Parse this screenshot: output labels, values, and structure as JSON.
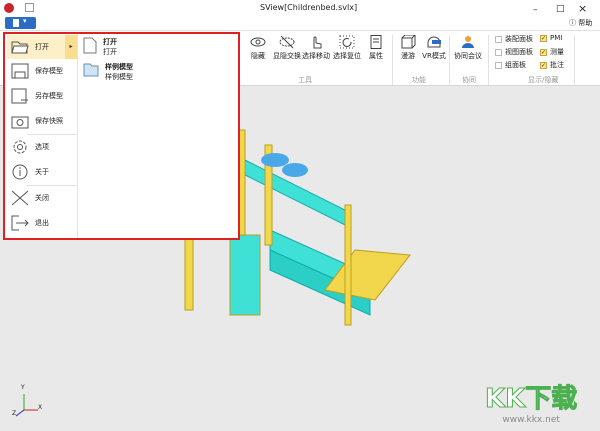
{
  "window": {
    "title": "SView[Childrenbed.svlx]",
    "minimize": "–",
    "maximize": "□",
    "close": "×",
    "help": "帮助"
  },
  "file_button": "file-menu",
  "ribbon": {
    "groups": [
      {
        "label": "工具",
        "buttons": [
          "隐藏",
          "显隐交换",
          "选择移动",
          "选择复位",
          "属性"
        ]
      },
      {
        "label": "功能",
        "buttons": [
          "漫游",
          "VR模式"
        ]
      },
      {
        "label": "协同",
        "buttons": [
          "协同会议"
        ]
      },
      {
        "label": "显示/隐藏",
        "checkboxes": [
          {
            "label": "装配面板",
            "checked": false
          },
          {
            "label": "视图面板",
            "checked": false
          },
          {
            "label": "组面板",
            "checked": false
          },
          {
            "label": "PMI",
            "checked": true
          },
          {
            "label": "测量",
            "checked": true
          },
          {
            "label": "批注",
            "checked": true
          }
        ]
      }
    ]
  },
  "menu": {
    "items": [
      "打开",
      "保存模型",
      "另存模型",
      "保存快照",
      "选项",
      "关于",
      "关闭",
      "退出"
    ],
    "submenu": [
      {
        "title": "打开",
        "subtitle": "打开"
      },
      {
        "title": "样例模型",
        "subtitle": "样例模型"
      }
    ]
  },
  "axis": {
    "x": "X",
    "y": "Y",
    "z": "Z"
  },
  "watermark": {
    "logo": "KK下载",
    "url": "www.kkx.net"
  },
  "colors": {
    "accent": "#2b6cc4",
    "menu_border": "#e02020",
    "wood": "#f2d64b",
    "mattress": "#3fe0d6"
  }
}
